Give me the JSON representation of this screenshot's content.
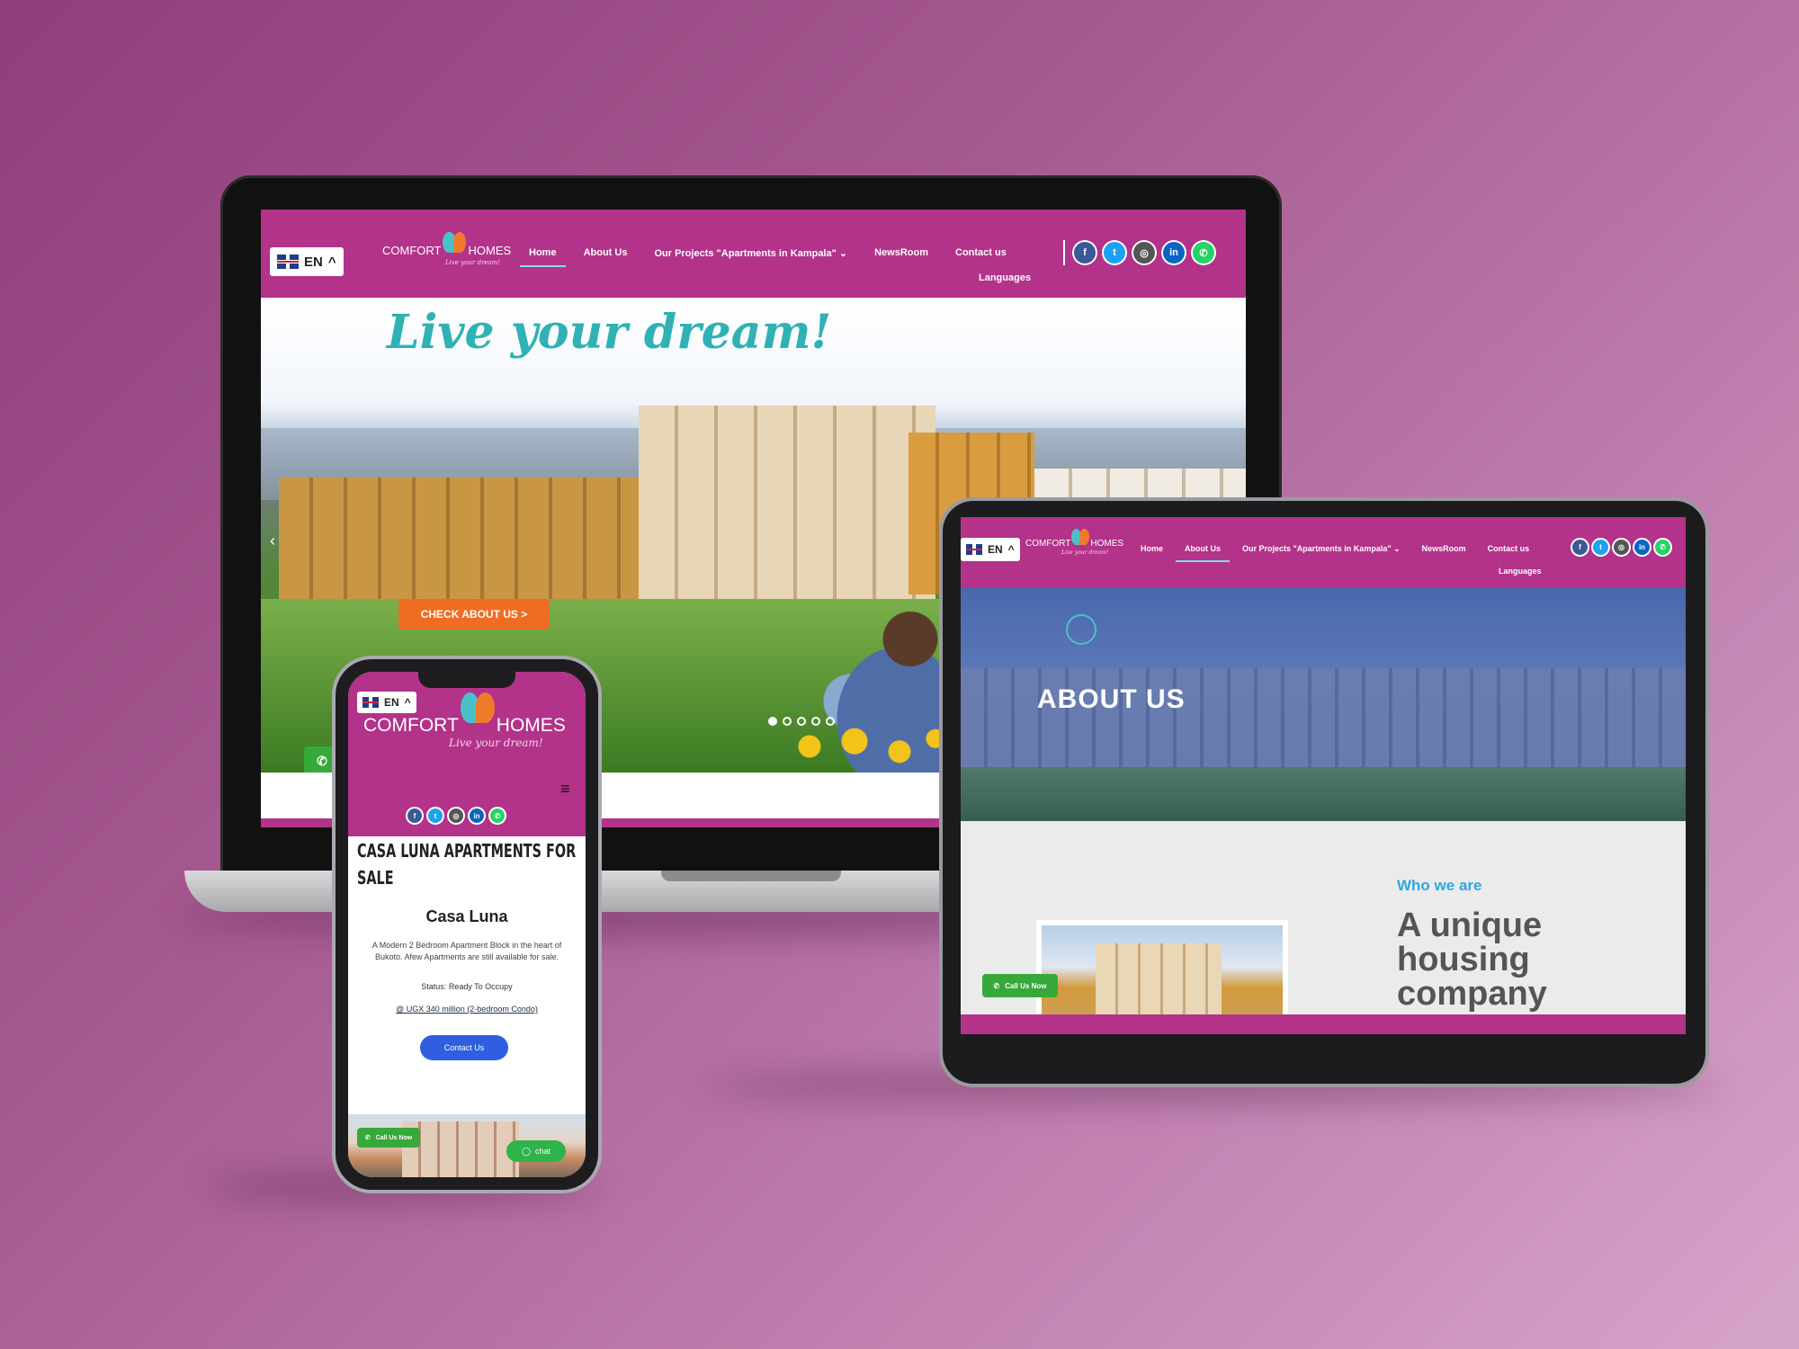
{
  "brand": {
    "logo_left": "COMFORT",
    "logo_right": "HOMES",
    "tagline": "Live your dream!",
    "colors": {
      "nav": "#b3328a",
      "accent_teal": "#2fb1b5",
      "cta_orange": "#ef6d22",
      "call_green": "#37a83a",
      "blue_button": "#2f5fe0"
    }
  },
  "language": {
    "code": "EN",
    "flag_icon": "uk-flag-icon",
    "caret_icon": "caret-up-icon"
  },
  "nav": {
    "items": [
      {
        "label": "Home"
      },
      {
        "label": "About Us"
      },
      {
        "label": "Our Projects \"Apartments in Kampala\"",
        "caret": "⌄"
      },
      {
        "label": "NewsRoom"
      },
      {
        "label": "Contact us"
      },
      {
        "label": "Languages"
      }
    ],
    "socials": [
      {
        "icon": "facebook-icon",
        "glyph": "f",
        "color": "#3b5998"
      },
      {
        "icon": "twitter-icon",
        "glyph": "t",
        "color": "#1da1f2"
      },
      {
        "icon": "instagram-icon",
        "glyph": "◎",
        "color": "#555555"
      },
      {
        "icon": "linkedin-icon",
        "glyph": "in",
        "color": "#0a66c2"
      },
      {
        "icon": "whatsapp-icon",
        "glyph": "✆",
        "color": "#25d366"
      }
    ]
  },
  "laptop": {
    "hero_title": "Live your dream!",
    "cta_label": "CHECK ABOUT US >",
    "slider_active": 1,
    "slider_count": 5
  },
  "tablet": {
    "hero_title": "ABOUT US",
    "kicker": "Who we are",
    "headline_1": "A unique",
    "headline_2": "housing",
    "headline_3": "company",
    "call_label": "Call Us Now"
  },
  "phone": {
    "title_1": "CASA LUNA APARTMENTS FOR",
    "title_2": "SALE",
    "subtitle": "Casa Luna",
    "desc": "A Modern 2 Bedroom Apartment Block in the heart of Bukoto. Afew Apartments are still available for sale.",
    "status": "Status: Ready To Occupy",
    "price": "@ UGX 340 million (2-bedroom Condo)",
    "contact_btn": "Contact Us",
    "call_label": "Call Us Now",
    "chat_label": "chat"
  }
}
